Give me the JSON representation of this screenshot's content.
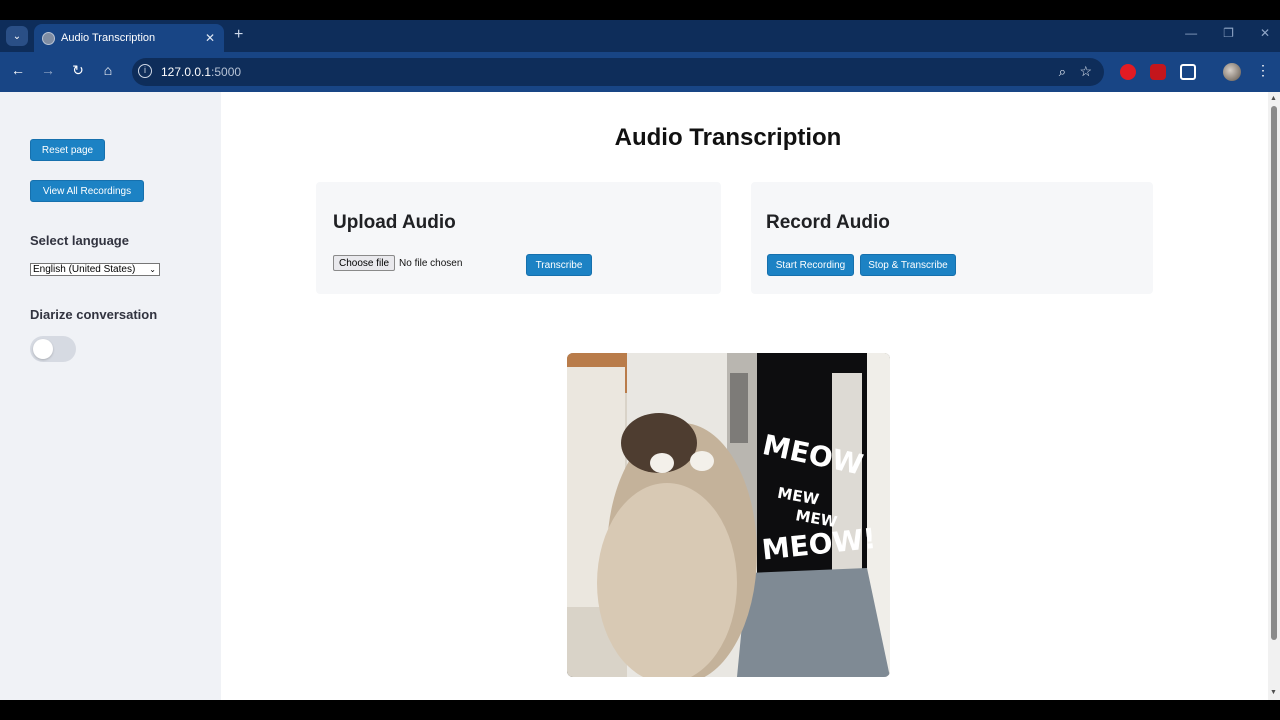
{
  "browser": {
    "tab_title": "Audio Transcription",
    "tab_close": "✕",
    "new_tab": "+",
    "url_host": "127.0.0.1",
    "url_port": ":5000",
    "back": "←",
    "forward": "→",
    "reload": "↻",
    "home": "⌂",
    "menu": "⋮"
  },
  "sidebar": {
    "reset_label": "Reset page",
    "view_all_label": "View All Recordings",
    "language_heading": "Select language",
    "language_selected": "English (United States)",
    "diarize_heading": "Diarize conversation",
    "diarize_enabled": false
  },
  "main": {
    "title": "Audio Transcription",
    "upload": {
      "title": "Upload Audio",
      "choose_file_label": "Choose file",
      "file_status": "No file chosen",
      "transcribe_label": "Transcribe"
    },
    "record": {
      "title": "Record Audio",
      "start_label": "Start Recording",
      "stop_label": "Stop & Transcribe"
    },
    "gif": {
      "text": [
        "MEOW",
        "MEW",
        "MEW",
        "MEOW!"
      ]
    }
  },
  "colors": {
    "accent": "#1c82c4",
    "browser_frame": "#184585",
    "sidebar_bg": "#f0f2f6"
  }
}
